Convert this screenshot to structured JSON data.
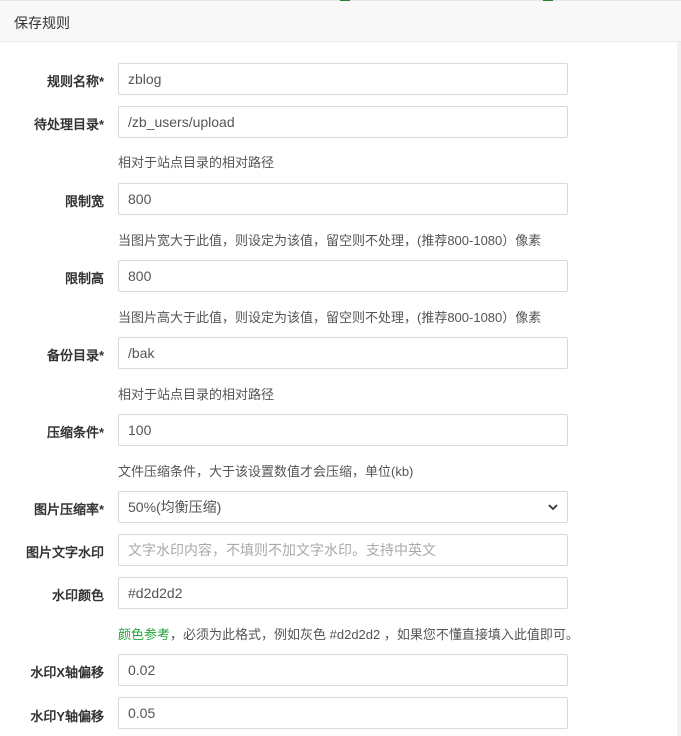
{
  "dialog": {
    "title": "保存规则"
  },
  "form": {
    "rule_name": {
      "label": "规则名称*",
      "value": "zblog"
    },
    "pending_dir": {
      "label": "待处理目录*",
      "value": "/zb_users/upload",
      "hint": "相对于站点目录的相对路径"
    },
    "max_width": {
      "label": "限制宽",
      "value": "800",
      "hint": "当图片宽大于此值，则设定为该值，留空则不处理，(推荐800-1080）像素"
    },
    "max_height": {
      "label": "限制高",
      "value": "800",
      "hint": "当图片高大于此值，则设定为该值，留空则不处理，(推荐800-1080）像素"
    },
    "backup_dir": {
      "label": "备份目录*",
      "value": "/bak",
      "hint": "相对于站点目录的相对路径"
    },
    "compress_condition": {
      "label": "压缩条件*",
      "value": "100",
      "hint": "文件压缩条件，大于该设置数值才会压缩，单位(kb)"
    },
    "compress_rate": {
      "label": "图片压缩率*",
      "selected": "50%(均衡压缩)"
    },
    "text_watermark": {
      "label": "图片文字水印",
      "placeholder": "文字水印内容，不填则不加文字水印。支持中英文",
      "value": ""
    },
    "watermark_color": {
      "label": "水印颜色",
      "value": "#d2d2d2",
      "hint_link": "颜色参考",
      "hint_rest": "，必须为此格式，例如灰色 #d2d2d2 ，如果您不懂直接填入此值即可。"
    },
    "watermark_x": {
      "label": "水印X轴偏移",
      "value": "0.02"
    },
    "watermark_y": {
      "label": "水印Y轴偏移",
      "value": "0.05"
    }
  },
  "colors": {
    "accent_green": "#20a53a",
    "header_bg": "#f8f8f8",
    "border": "#d9d9d9"
  },
  "icons": {
    "select_arrow": "chevron-down-icon"
  }
}
